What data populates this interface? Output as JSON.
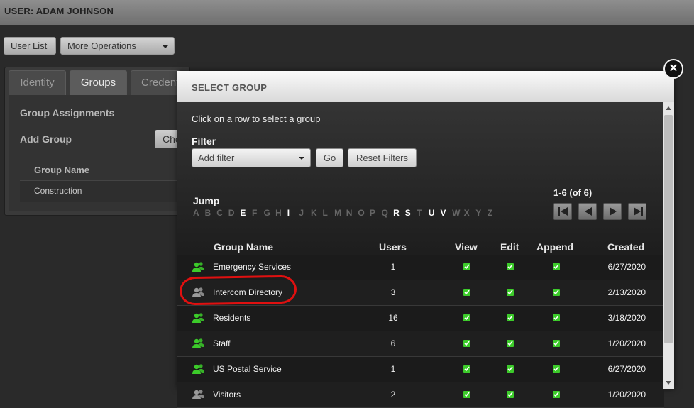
{
  "topbar": {
    "user_label": "USER: ADAM JOHNSON"
  },
  "toolbar": {
    "user_list": "User List",
    "more_operations": "More Operations"
  },
  "tabs": [
    {
      "label": "Identity"
    },
    {
      "label": "Groups"
    },
    {
      "label": "Credentials"
    }
  ],
  "groups_panel": {
    "assignments_label": "Group Assignments",
    "add_group_label": "Add Group",
    "choose_button": "Choose",
    "column_group_name": "Group Name",
    "rows": [
      "Construction"
    ]
  },
  "modal": {
    "title": "SELECT GROUP",
    "close_symbol": "×",
    "instruction": "Click on a row to select a group",
    "filter_label": "Filter",
    "filter_select_value": "Add filter",
    "go_button": "Go",
    "reset_button": "Reset Filters",
    "jump_label": "Jump",
    "letters": [
      {
        "l": "A",
        "on": false
      },
      {
        "l": "B",
        "on": false
      },
      {
        "l": "C",
        "on": false
      },
      {
        "l": "D",
        "on": false
      },
      {
        "l": "E",
        "on": true
      },
      {
        "l": "F",
        "on": false
      },
      {
        "l": "G",
        "on": false
      },
      {
        "l": "H",
        "on": false
      },
      {
        "l": "I",
        "on": true
      },
      {
        "l": "J",
        "on": false
      },
      {
        "l": "K",
        "on": false
      },
      {
        "l": "L",
        "on": false
      },
      {
        "l": "M",
        "on": false
      },
      {
        "l": "N",
        "on": false
      },
      {
        "l": "O",
        "on": false
      },
      {
        "l": "P",
        "on": false
      },
      {
        "l": "Q",
        "on": false
      },
      {
        "l": "R",
        "on": true
      },
      {
        "l": "S",
        "on": true
      },
      {
        "l": "T",
        "on": false
      },
      {
        "l": "U",
        "on": true
      },
      {
        "l": "V",
        "on": true
      },
      {
        "l": "W",
        "on": false
      },
      {
        "l": "X",
        "on": false
      },
      {
        "l": "Y",
        "on": false
      },
      {
        "l": "Z",
        "on": false
      }
    ],
    "page_info": "1-6 (of 6)",
    "columns": {
      "group_name": "Group Name",
      "users": "Users",
      "view": "View",
      "edit": "Edit",
      "append": "Append",
      "created": "Created"
    },
    "rows": [
      {
        "name": "Emergency Services",
        "users": "1",
        "view": true,
        "edit": true,
        "append": true,
        "created": "6/27/2020",
        "icon": "group-icon-green"
      },
      {
        "name": "Intercom Directory",
        "users": "3",
        "view": true,
        "edit": true,
        "append": true,
        "created": "2/13/2020",
        "icon": "group-icon-gray"
      },
      {
        "name": "Residents",
        "users": "16",
        "view": true,
        "edit": true,
        "append": true,
        "created": "3/18/2020",
        "icon": "group-icon-green"
      },
      {
        "name": "Staff",
        "users": "6",
        "view": true,
        "edit": true,
        "append": true,
        "created": "1/20/2020",
        "icon": "group-icon-green"
      },
      {
        "name": "US Postal Service",
        "users": "1",
        "view": true,
        "edit": true,
        "append": true,
        "created": "6/27/2020",
        "icon": "group-icon-green"
      },
      {
        "name": "Visitors",
        "users": "2",
        "view": true,
        "edit": true,
        "append": true,
        "created": "1/20/2020",
        "icon": "group-icon-gray"
      }
    ]
  },
  "colors": {
    "accent_green": "#3ccb2a",
    "annotation_red": "#e01010",
    "header_gray": "#d9d9d9"
  }
}
